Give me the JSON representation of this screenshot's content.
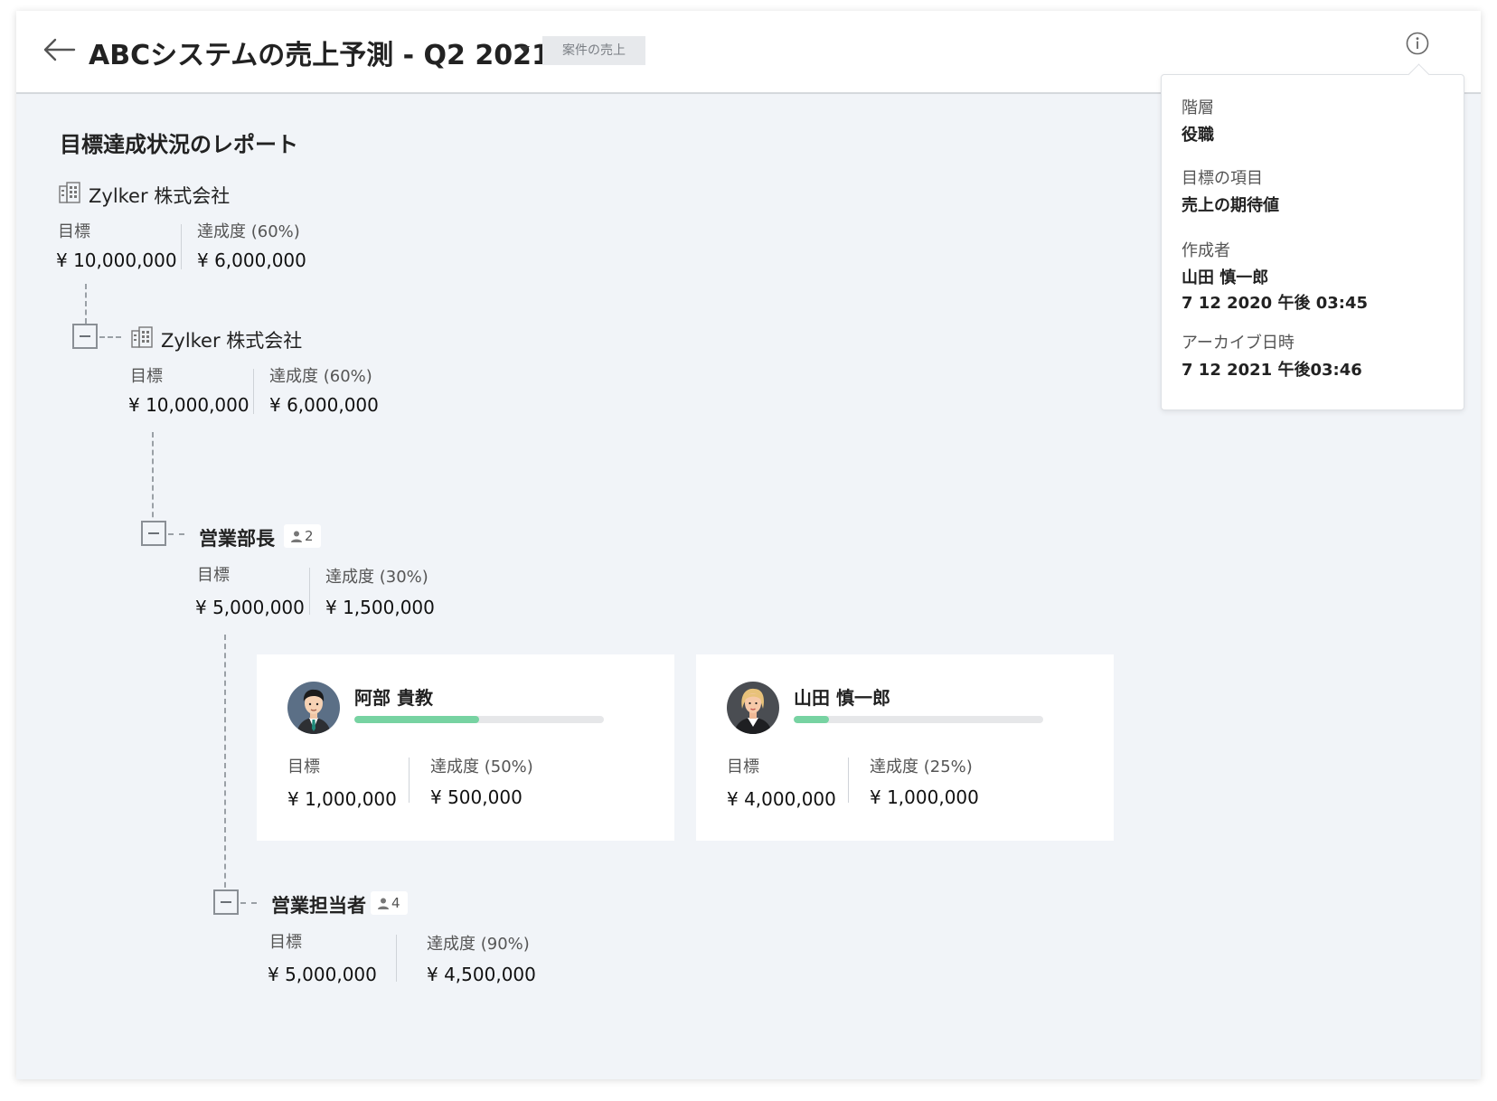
{
  "header": {
    "title": "ABCシステムの売上予測 - Q2 2021",
    "tag": "案件の売上"
  },
  "report": {
    "title": "目標達成状況のレポート"
  },
  "labels": {
    "target": "目標"
  },
  "tree": {
    "org_root": {
      "name": "Zylker 株式会社",
      "achievement_label": "達成度 (60%)",
      "target": "¥ 10,000,000",
      "achieved": "¥ 6,000,000"
    },
    "org_child": {
      "name": "Zylker 株式会社",
      "achievement_label": "達成度 (60%)",
      "target": "¥ 10,000,000",
      "achieved": "¥ 6,000,000"
    },
    "manager_role": {
      "name": "営業部長",
      "member_count": "2",
      "achievement_label": "達成度 (30%)",
      "target": "¥ 5,000,000",
      "achieved": "¥ 1,500,000"
    },
    "members": [
      {
        "name": "阿部 貴教",
        "progress": 0.5,
        "achievement_label": "達成度 (50%)",
        "target": "¥ 1,000,000",
        "achieved": "¥ 500,000"
      },
      {
        "name": "山田 慎一郎",
        "progress": 0.14,
        "achievement_label": "達成度 (25%)",
        "target": "¥ 4,000,000",
        "achieved": "¥ 1,000,000"
      }
    ],
    "rep_role": {
      "name": "営業担当者",
      "member_count": "4",
      "achievement_label": "達成度 (90%)",
      "target": "¥ 5,000,000",
      "achieved": "¥ 4,500,000"
    }
  },
  "info_popover": {
    "hierarchy_label": "階層",
    "hierarchy_value": "役職",
    "target_item_label": "目標の項目",
    "target_item_value": "売上の期待値",
    "creator_label": "作成者",
    "creator_name": "山田 慎一郎",
    "created_at": "7 12 2020 午後 03:45",
    "archived_label": "アーカイブ日時",
    "archived_at": "7 12 2021  午後03:46"
  },
  "colors": {
    "background": "#f1f4f8",
    "progress_fill": "#77d3a2",
    "progress_track": "#e6e7e9"
  }
}
